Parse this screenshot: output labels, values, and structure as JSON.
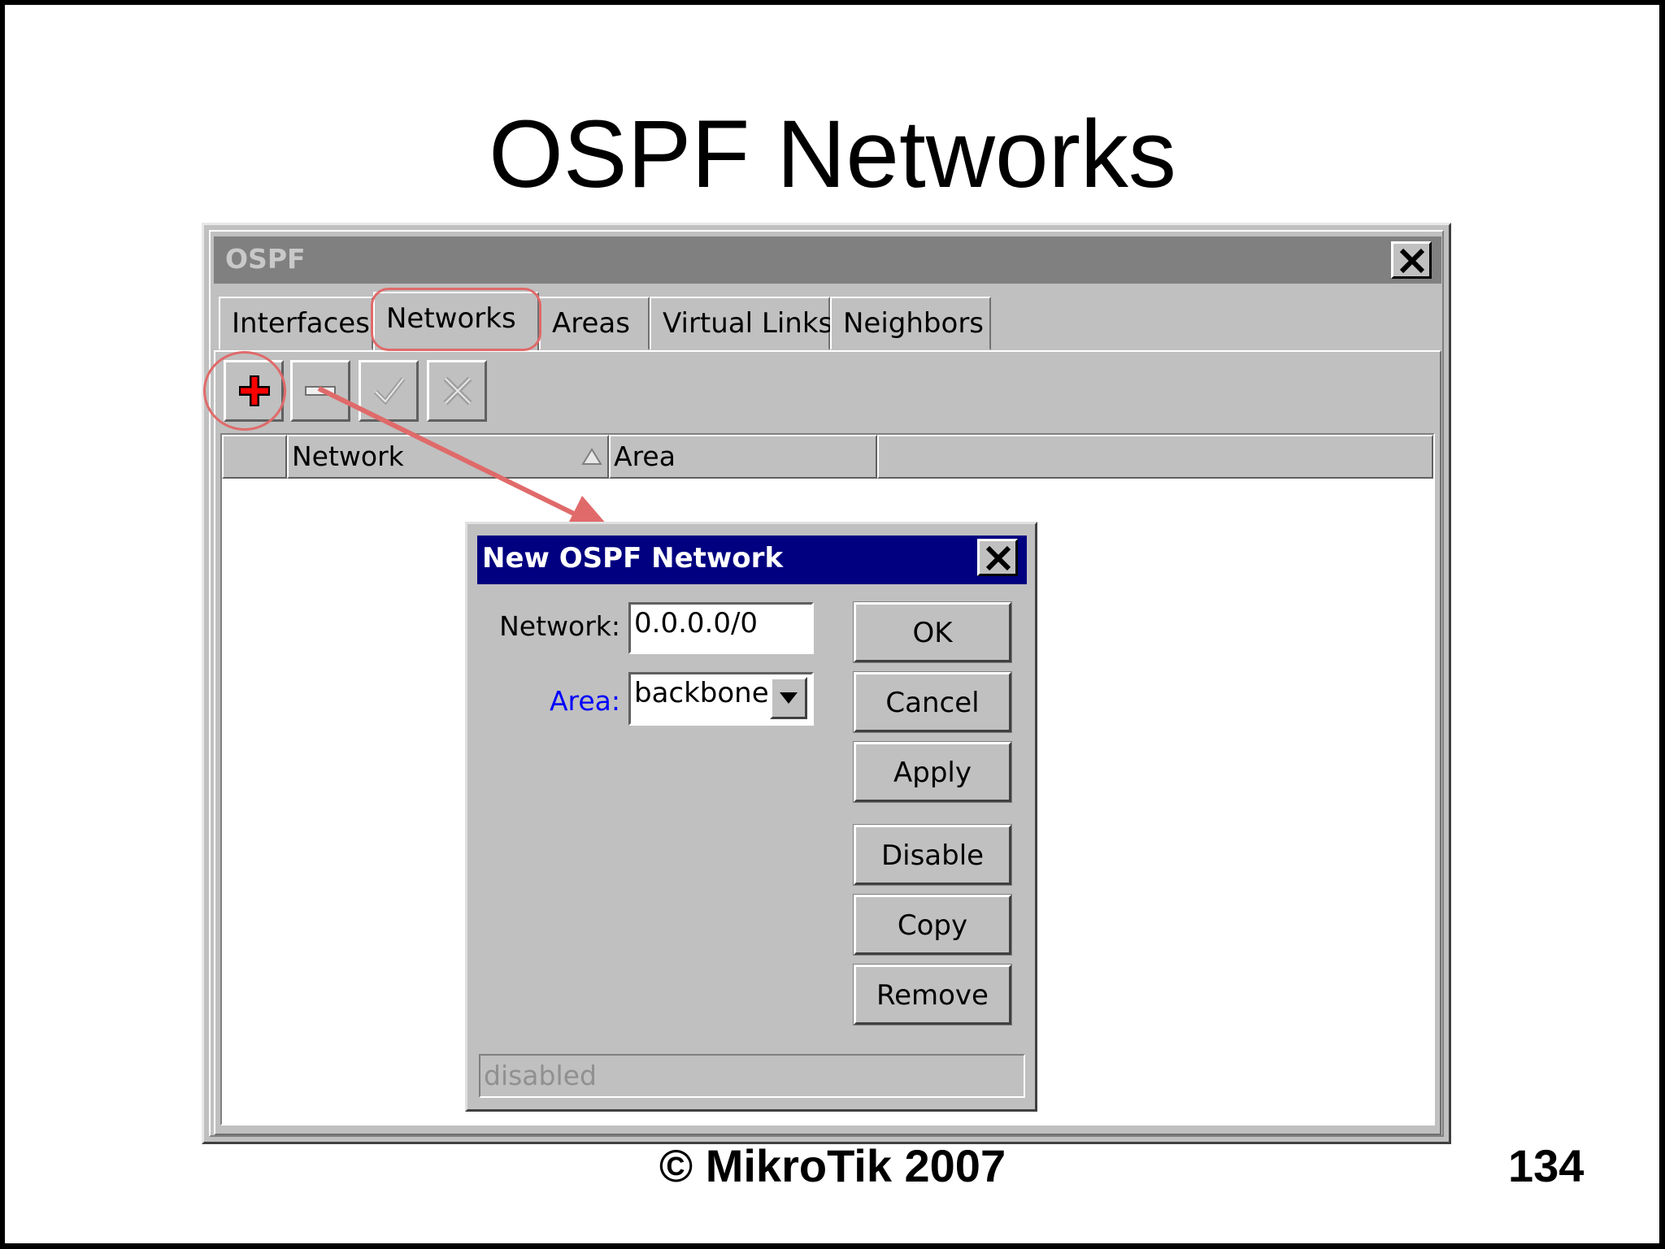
{
  "slide": {
    "title": "OSPF Networks",
    "footer": "© MikroTik 2007",
    "page_number": "134"
  },
  "window": {
    "title": "OSPF",
    "close_icon": "close-icon",
    "tabs": [
      {
        "label": "Interfaces",
        "active": false
      },
      {
        "label": "Networks",
        "active": true
      },
      {
        "label": "Areas",
        "active": false
      },
      {
        "label": "Virtual Links",
        "active": false
      },
      {
        "label": "Neighbors",
        "active": false
      }
    ],
    "toolbar": [
      {
        "icon": "plus-icon",
        "color": "#ff0000"
      },
      {
        "icon": "minus-icon"
      },
      {
        "icon": "check-icon"
      },
      {
        "icon": "cross-icon"
      }
    ],
    "columns": [
      "Network",
      "Area"
    ],
    "sort_column": "Network",
    "sort_icon": "sort-ascending-icon"
  },
  "dialog": {
    "title": "New OSPF Network",
    "title_bg": "#000080",
    "fields": {
      "network_label": "Network:",
      "network_value": "0.0.0.0/0",
      "area_label": "Area:",
      "area_label_color": "#0000ff",
      "area_value": "backbone"
    },
    "buttons": {
      "ok": "OK",
      "cancel": "Cancel",
      "apply": "Apply",
      "disable": "Disable",
      "copy": "Copy",
      "remove": "Remove"
    },
    "status": "disabled"
  },
  "annotation": {
    "highlight_color": "#e06a6a"
  }
}
